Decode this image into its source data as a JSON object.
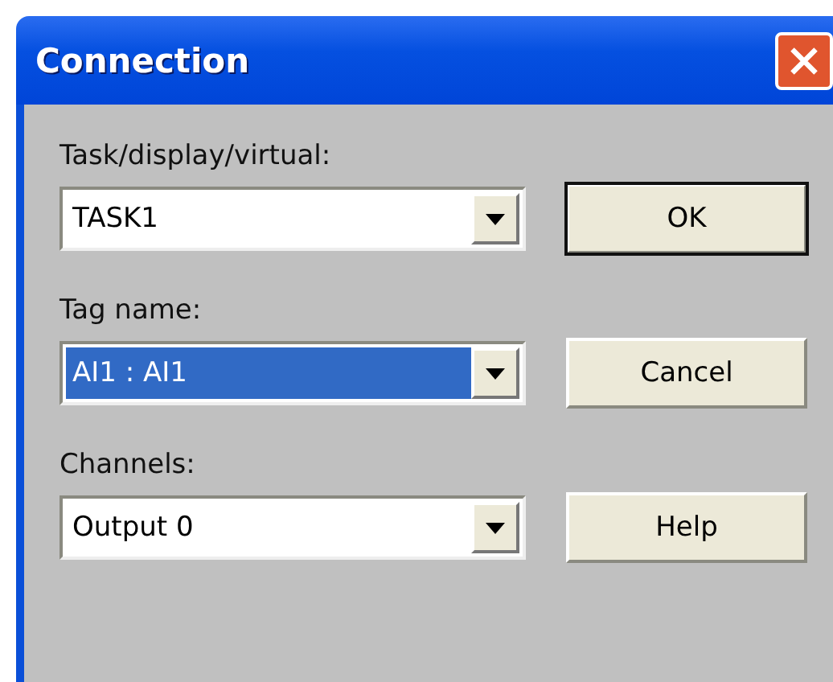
{
  "window": {
    "title": "Connection"
  },
  "fields": [
    {
      "label": "Task/display/virtual:",
      "value": "TASK1",
      "selected": false,
      "button": {
        "label": "OK",
        "default": true
      }
    },
    {
      "label": "Tag name:",
      "value": "AI1 : AI1",
      "selected": true,
      "button": {
        "label": "Cancel",
        "default": false
      }
    },
    {
      "label": "Channels:",
      "value": "Output 0",
      "selected": false,
      "button": {
        "label": "Help",
        "default": false
      }
    }
  ]
}
